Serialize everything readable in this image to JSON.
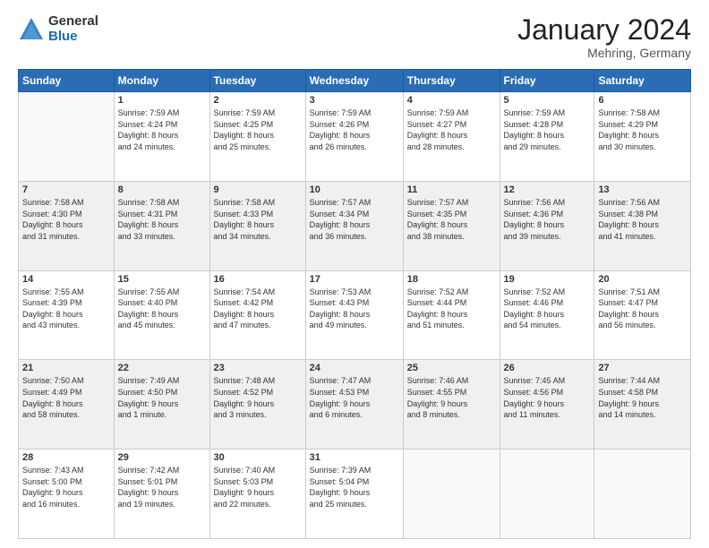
{
  "header": {
    "logo_general": "General",
    "logo_blue": "Blue",
    "month_title": "January 2024",
    "location": "Mehring, Germany"
  },
  "columns": [
    "Sunday",
    "Monday",
    "Tuesday",
    "Wednesday",
    "Thursday",
    "Friday",
    "Saturday"
  ],
  "weeks": [
    {
      "shaded": false,
      "days": [
        {
          "num": "",
          "info": ""
        },
        {
          "num": "1",
          "info": "Sunrise: 7:59 AM\nSunset: 4:24 PM\nDaylight: 8 hours\nand 24 minutes."
        },
        {
          "num": "2",
          "info": "Sunrise: 7:59 AM\nSunset: 4:25 PM\nDaylight: 8 hours\nand 25 minutes."
        },
        {
          "num": "3",
          "info": "Sunrise: 7:59 AM\nSunset: 4:26 PM\nDaylight: 8 hours\nand 26 minutes."
        },
        {
          "num": "4",
          "info": "Sunrise: 7:59 AM\nSunset: 4:27 PM\nDaylight: 8 hours\nand 28 minutes."
        },
        {
          "num": "5",
          "info": "Sunrise: 7:59 AM\nSunset: 4:28 PM\nDaylight: 8 hours\nand 29 minutes."
        },
        {
          "num": "6",
          "info": "Sunrise: 7:58 AM\nSunset: 4:29 PM\nDaylight: 8 hours\nand 30 minutes."
        }
      ]
    },
    {
      "shaded": true,
      "days": [
        {
          "num": "7",
          "info": "Sunrise: 7:58 AM\nSunset: 4:30 PM\nDaylight: 8 hours\nand 31 minutes."
        },
        {
          "num": "8",
          "info": "Sunrise: 7:58 AM\nSunset: 4:31 PM\nDaylight: 8 hours\nand 33 minutes."
        },
        {
          "num": "9",
          "info": "Sunrise: 7:58 AM\nSunset: 4:33 PM\nDaylight: 8 hours\nand 34 minutes."
        },
        {
          "num": "10",
          "info": "Sunrise: 7:57 AM\nSunset: 4:34 PM\nDaylight: 8 hours\nand 36 minutes."
        },
        {
          "num": "11",
          "info": "Sunrise: 7:57 AM\nSunset: 4:35 PM\nDaylight: 8 hours\nand 38 minutes."
        },
        {
          "num": "12",
          "info": "Sunrise: 7:56 AM\nSunset: 4:36 PM\nDaylight: 8 hours\nand 39 minutes."
        },
        {
          "num": "13",
          "info": "Sunrise: 7:56 AM\nSunset: 4:38 PM\nDaylight: 8 hours\nand 41 minutes."
        }
      ]
    },
    {
      "shaded": false,
      "days": [
        {
          "num": "14",
          "info": "Sunrise: 7:55 AM\nSunset: 4:39 PM\nDaylight: 8 hours\nand 43 minutes."
        },
        {
          "num": "15",
          "info": "Sunrise: 7:55 AM\nSunset: 4:40 PM\nDaylight: 8 hours\nand 45 minutes."
        },
        {
          "num": "16",
          "info": "Sunrise: 7:54 AM\nSunset: 4:42 PM\nDaylight: 8 hours\nand 47 minutes."
        },
        {
          "num": "17",
          "info": "Sunrise: 7:53 AM\nSunset: 4:43 PM\nDaylight: 8 hours\nand 49 minutes."
        },
        {
          "num": "18",
          "info": "Sunrise: 7:52 AM\nSunset: 4:44 PM\nDaylight: 8 hours\nand 51 minutes."
        },
        {
          "num": "19",
          "info": "Sunrise: 7:52 AM\nSunset: 4:46 PM\nDaylight: 8 hours\nand 54 minutes."
        },
        {
          "num": "20",
          "info": "Sunrise: 7:51 AM\nSunset: 4:47 PM\nDaylight: 8 hours\nand 56 minutes."
        }
      ]
    },
    {
      "shaded": true,
      "days": [
        {
          "num": "21",
          "info": "Sunrise: 7:50 AM\nSunset: 4:49 PM\nDaylight: 8 hours\nand 58 minutes."
        },
        {
          "num": "22",
          "info": "Sunrise: 7:49 AM\nSunset: 4:50 PM\nDaylight: 9 hours\nand 1 minute."
        },
        {
          "num": "23",
          "info": "Sunrise: 7:48 AM\nSunset: 4:52 PM\nDaylight: 9 hours\nand 3 minutes."
        },
        {
          "num": "24",
          "info": "Sunrise: 7:47 AM\nSunset: 4:53 PM\nDaylight: 9 hours\nand 6 minutes."
        },
        {
          "num": "25",
          "info": "Sunrise: 7:46 AM\nSunset: 4:55 PM\nDaylight: 9 hours\nand 8 minutes."
        },
        {
          "num": "26",
          "info": "Sunrise: 7:45 AM\nSunset: 4:56 PM\nDaylight: 9 hours\nand 11 minutes."
        },
        {
          "num": "27",
          "info": "Sunrise: 7:44 AM\nSunset: 4:58 PM\nDaylight: 9 hours\nand 14 minutes."
        }
      ]
    },
    {
      "shaded": false,
      "days": [
        {
          "num": "28",
          "info": "Sunrise: 7:43 AM\nSunset: 5:00 PM\nDaylight: 9 hours\nand 16 minutes."
        },
        {
          "num": "29",
          "info": "Sunrise: 7:42 AM\nSunset: 5:01 PM\nDaylight: 9 hours\nand 19 minutes."
        },
        {
          "num": "30",
          "info": "Sunrise: 7:40 AM\nSunset: 5:03 PM\nDaylight: 9 hours\nand 22 minutes."
        },
        {
          "num": "31",
          "info": "Sunrise: 7:39 AM\nSunset: 5:04 PM\nDaylight: 9 hours\nand 25 minutes."
        },
        {
          "num": "",
          "info": ""
        },
        {
          "num": "",
          "info": ""
        },
        {
          "num": "",
          "info": ""
        }
      ]
    }
  ]
}
